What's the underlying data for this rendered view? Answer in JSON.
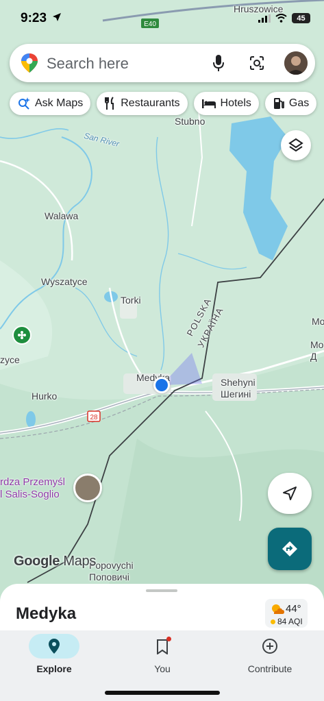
{
  "status_bar": {
    "time": "9:23",
    "battery": "45"
  },
  "search": {
    "placeholder": "Search here"
  },
  "chips": [
    {
      "label": "Ask Maps",
      "icon": "sparkle-search-icon"
    },
    {
      "label": "Restaurants",
      "icon": "fork-knife-icon"
    },
    {
      "label": "Hotels",
      "icon": "bed-icon"
    },
    {
      "label": "Gas",
      "icon": "gas-pump-icon"
    }
  ],
  "map": {
    "road_shield_e40": "E40",
    "road_shield_28": "28",
    "labels": {
      "hruszowice": "Hruszowice",
      "stubno": "Stubno",
      "san_river": "San River",
      "walawa": "Walawa",
      "wyszatyce": "Wyszatyce",
      "torki": "Torki",
      "medyka": "Medyka",
      "hurko": "Hurko",
      "shehyni": "Shehyni",
      "shehyni_uk": "Шегині",
      "polska": "POLSKA",
      "ukraina": "УКРАЇНА",
      "zyce": "zyce",
      "popovychi": "Popovychi",
      "popovychi_uk": "Поповичі",
      "right_mo1": "Mo",
      "right_mo2": "Mo",
      "right_d": "Д"
    },
    "poi": {
      "line1": "rdza Przemyśl",
      "line2": "l Salis-Soglio"
    },
    "logo_bold": "Google",
    "logo_light": "Maps"
  },
  "sheet": {
    "place_name": "Medyka",
    "weather_temp": "44°",
    "weather_aqi": "84 AQI"
  },
  "bottom_nav": [
    {
      "label": "Explore",
      "icon": "location-pin-icon",
      "active": true
    },
    {
      "label": "You",
      "icon": "bookmark-icon",
      "active": false
    },
    {
      "label": "Contribute",
      "icon": "plus-circle-icon",
      "active": false
    }
  ],
  "colors": {
    "accent": "#0b6b7a",
    "land": "#cfe9d9",
    "water": "#7fc9e8",
    "user_location": "#1a73e8"
  }
}
